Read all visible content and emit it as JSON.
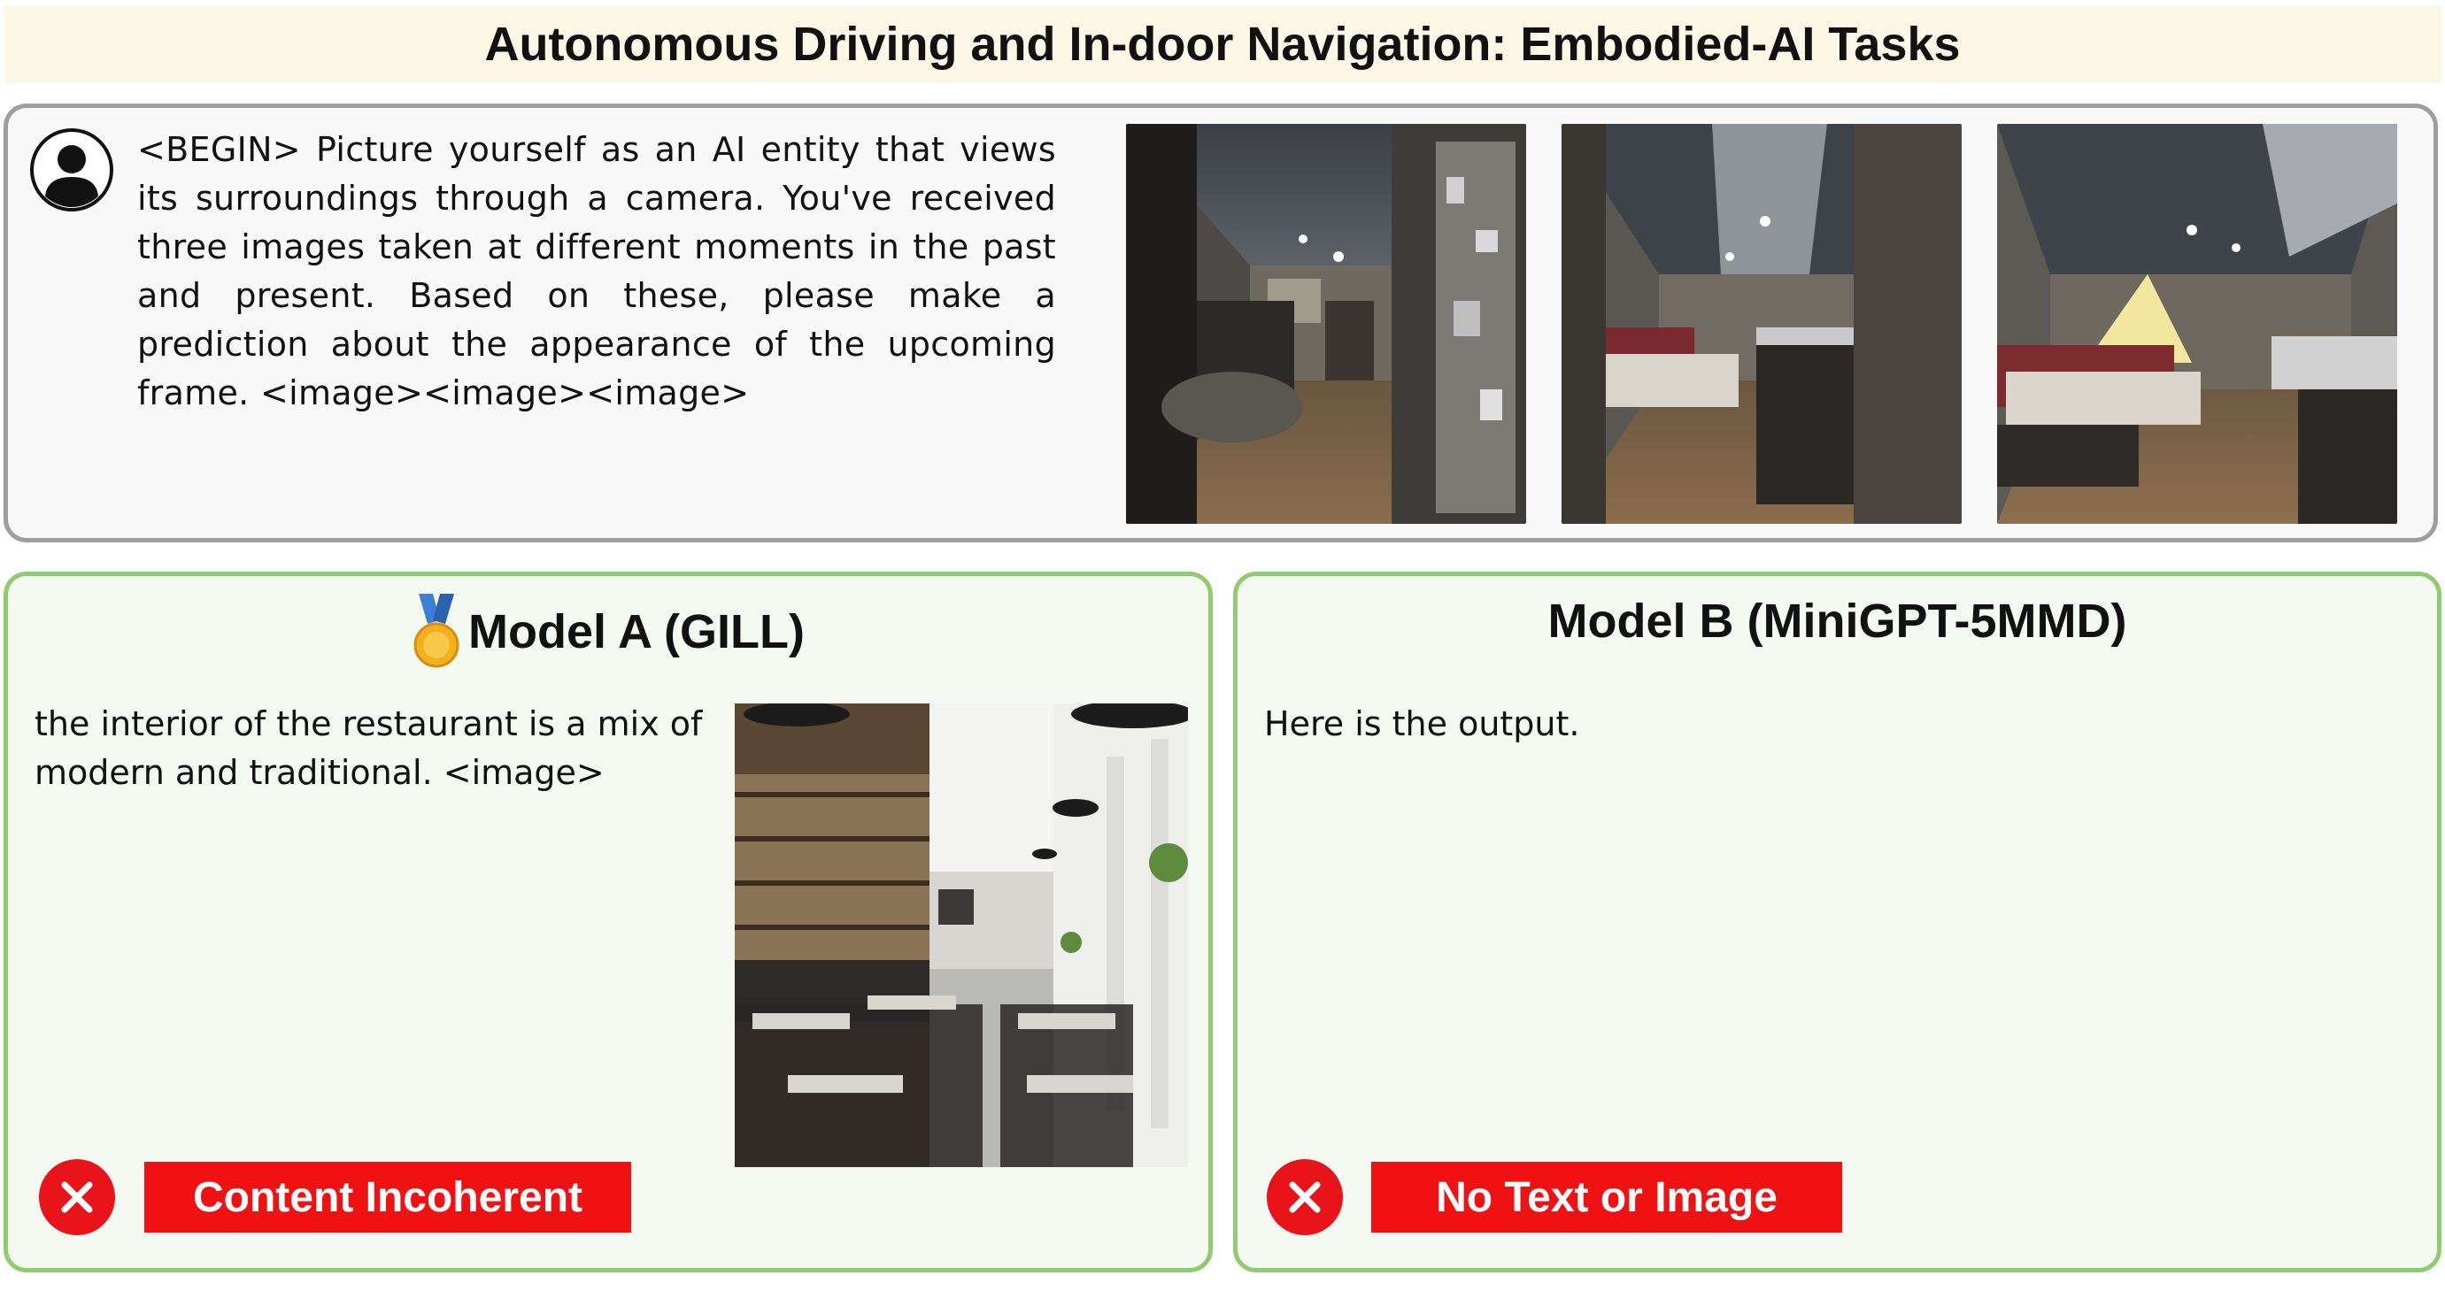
{
  "header": {
    "title": "Autonomous Driving and In-door Navigation: Embodied-AI Tasks"
  },
  "prompt": {
    "text": "<BEGIN> Picture yourself as an AI entity that views its surroundings through a camera. You've received three images taken at different moments in the past and present. Based on these, please make a prediction about the appearance of the upcoming frame. <image><image><image>",
    "user_icon": "user-avatar-icon",
    "frames": [
      "restaurant-corridor-frame-1",
      "restaurant-corridor-frame-2",
      "restaurant-corridor-frame-3"
    ]
  },
  "model_a": {
    "medal_icon": "gold-medal-icon",
    "title": "Model A (GILL)",
    "text": "the interior of the restaurant is a mix of modern and traditional. <image>",
    "image": "generated-restaurant-interior",
    "verdict": "Content Incoherent",
    "verdict_icon": "close-icon"
  },
  "model_b": {
    "title": "Model B (MiniGPT-5MMD)",
    "text": "Here is the output.",
    "verdict": "No Text or Image",
    "verdict_icon": "close-icon"
  },
  "colors": {
    "banner_bg": "#fdf7e6",
    "prompt_border": "#9e9e9e",
    "model_border": "#8fcc6e",
    "model_bg": "#f4f9f1",
    "verdict_red": "#f01212"
  }
}
